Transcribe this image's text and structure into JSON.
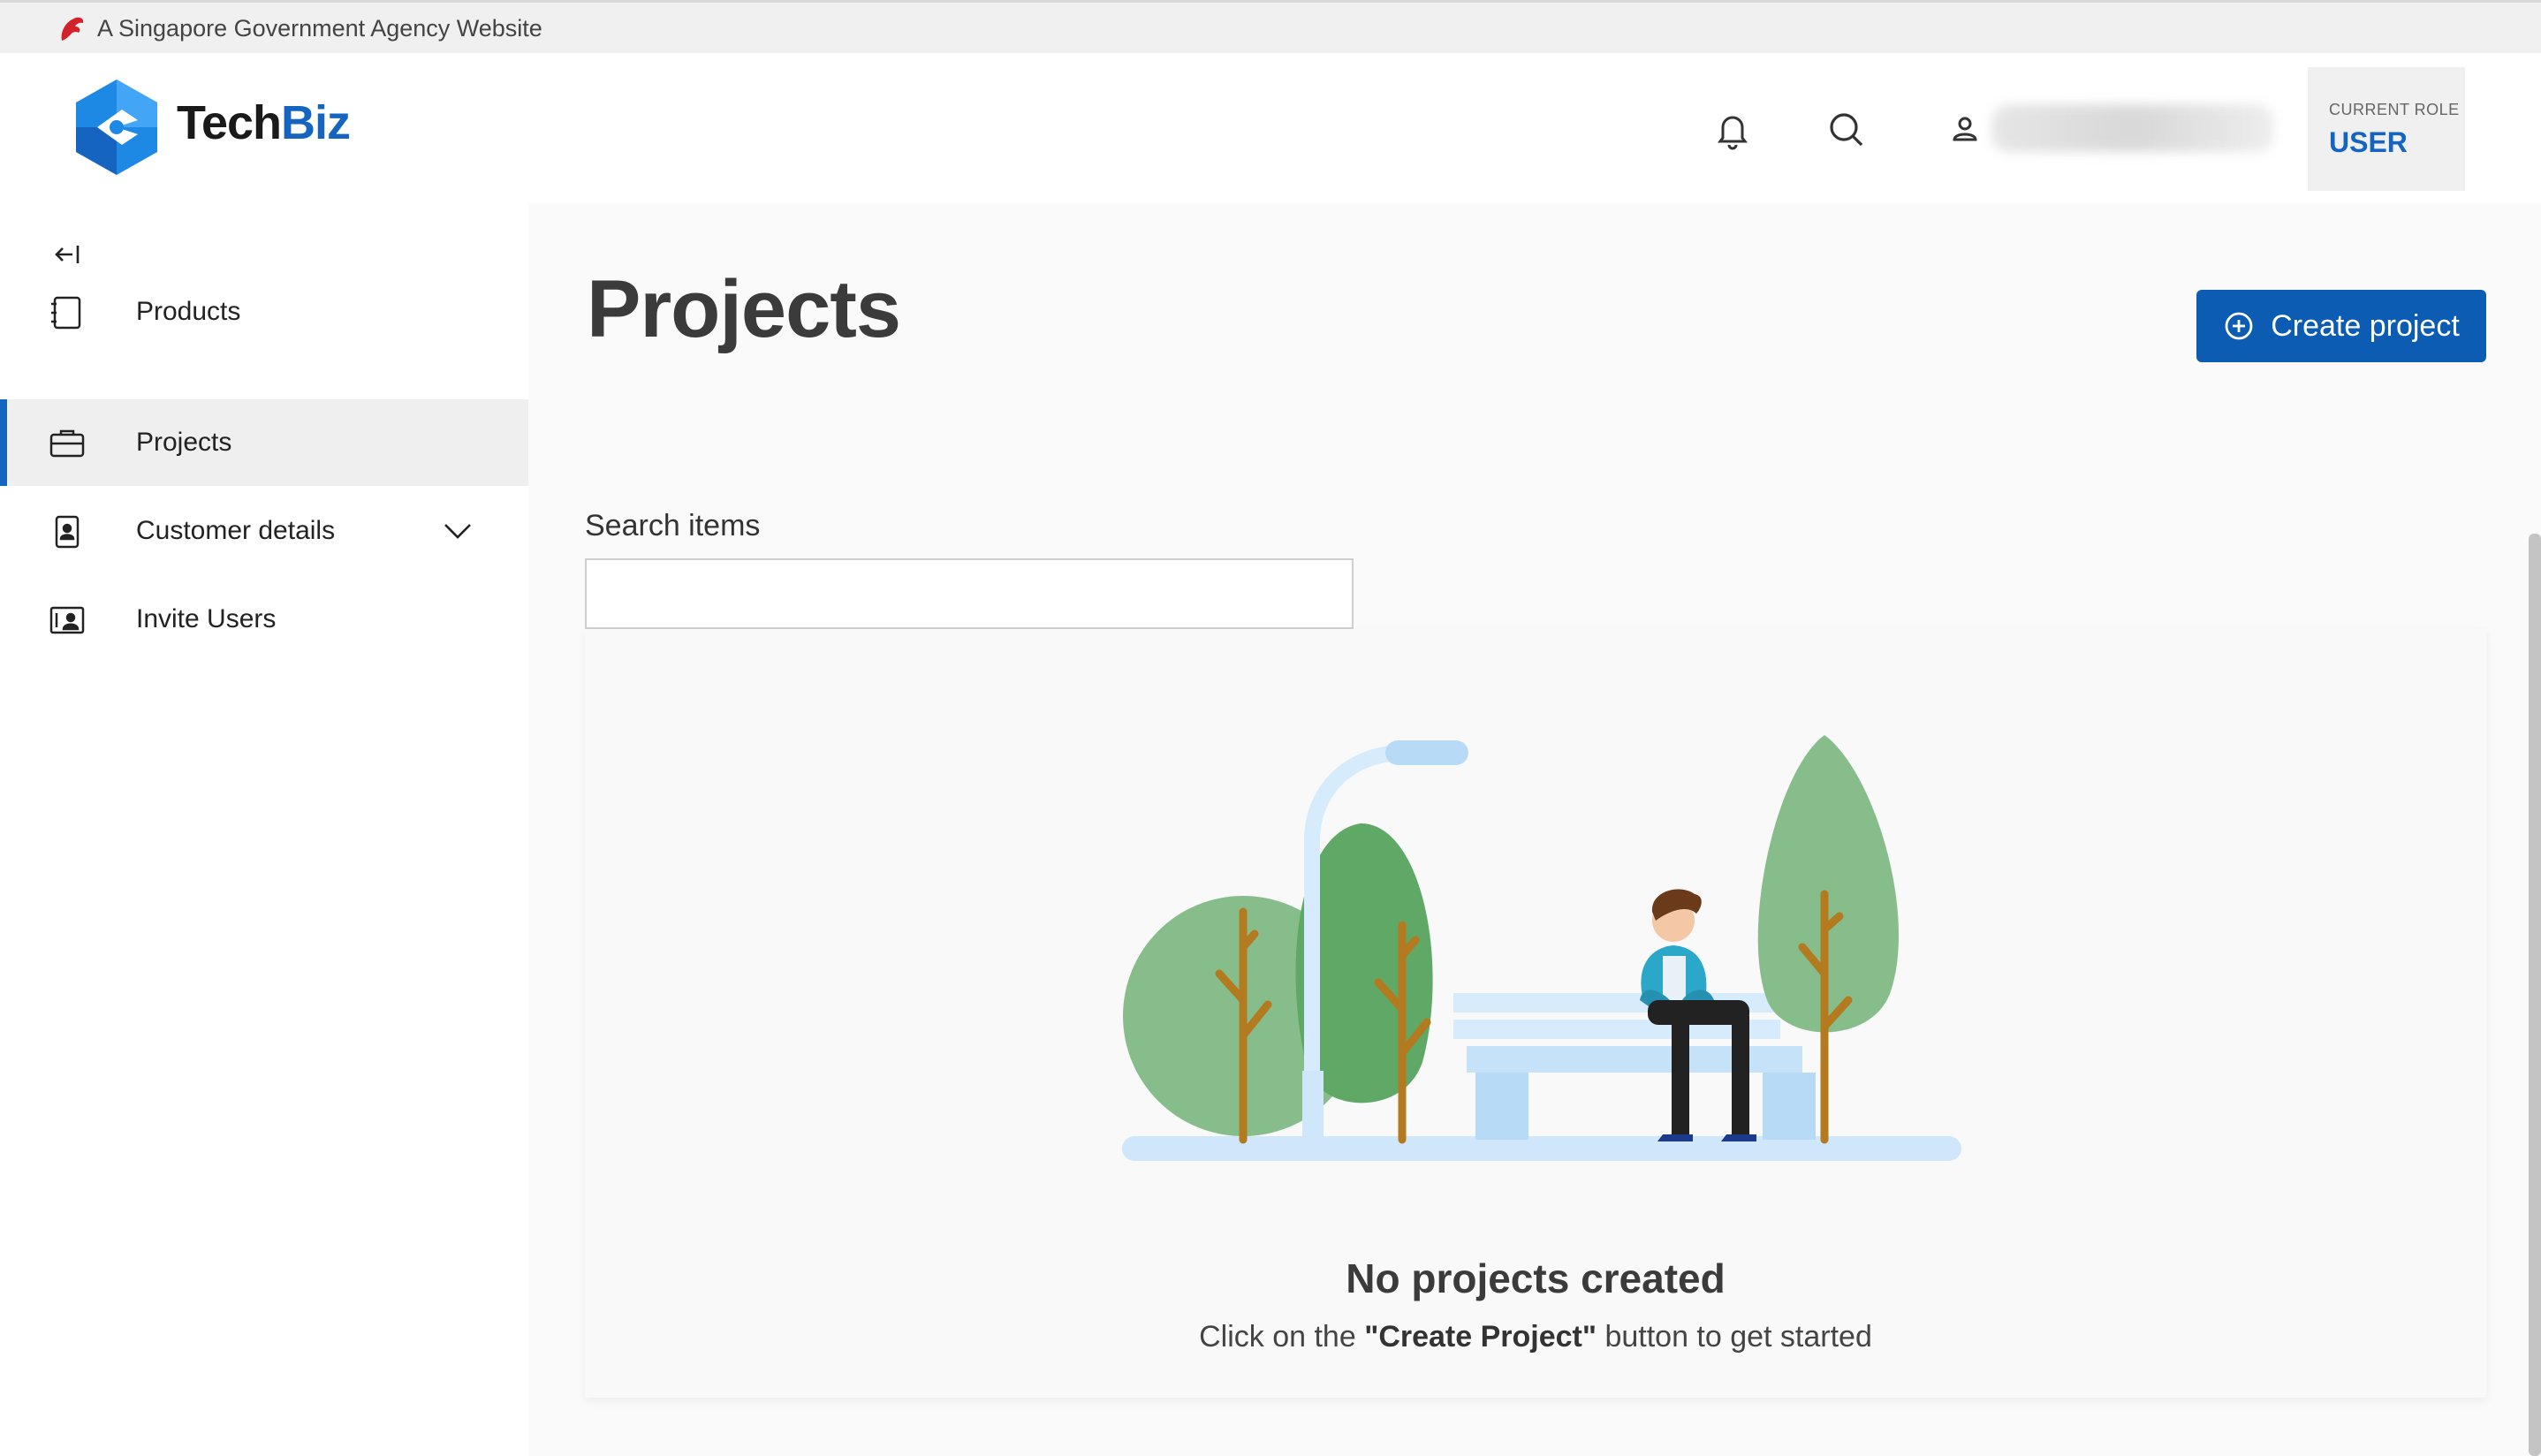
{
  "masthead": {
    "text": "A Singapore Government Agency Website",
    "icon": "lion-head-icon"
  },
  "header": {
    "brand_part1": "Tech",
    "brand_part2": "Biz",
    "role_label": "CURRENT ROLE",
    "role_value": "USER",
    "icons": [
      "bell-icon",
      "search-icon",
      "user-icon"
    ]
  },
  "sidebar": {
    "collapse_icon": "collapse-left-icon",
    "items": [
      {
        "label": "Products",
        "icon": "notebook-icon",
        "active": false
      },
      {
        "label": "Projects",
        "icon": "briefcase-icon",
        "active": true
      },
      {
        "label": "Customer details",
        "icon": "contact-badge-icon",
        "active": false,
        "expandable": true
      },
      {
        "label": "Invite Users",
        "icon": "contact-card-icon",
        "active": false
      }
    ]
  },
  "main": {
    "title": "Projects",
    "create_button": "Create project",
    "search_label": "Search items",
    "search_value": "",
    "empty_title": "No projects created",
    "empty_sub_before": "Click on the ",
    "empty_sub_bold": "\"Create Project\"",
    "empty_sub_after": " button to get started"
  },
  "colors": {
    "accent": "#1565c0",
    "button": "#0c5cb3",
    "masthead_bg": "#f0f0f0",
    "main_bg": "#fafafa"
  }
}
